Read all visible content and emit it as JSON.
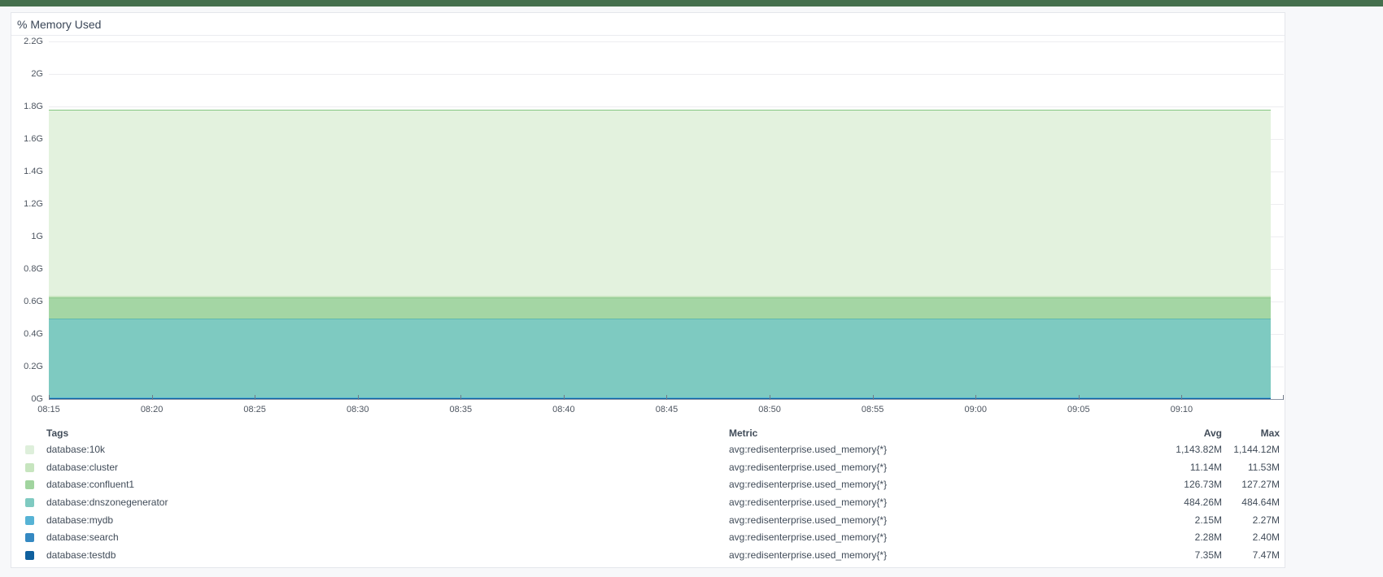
{
  "page": {
    "top_bar_color": "#45704d",
    "background_color": "#f7f8fa"
  },
  "panel": {
    "title": "% Memory Used"
  },
  "legend": {
    "headers": {
      "tags": "Tags",
      "metric": "Metric",
      "avg": "Avg",
      "max": "Max"
    }
  },
  "chart_data": {
    "type": "area",
    "stacked": true,
    "title": "% Memory Used",
    "grid": true,
    "legend_position": "bottom-table",
    "x_tick_labels": [
      "08:15",
      "08:20",
      "08:25",
      "08:30",
      "08:35",
      "08:40",
      "08:45",
      "08:50",
      "08:55",
      "09:00",
      "09:05",
      "09:10"
    ],
    "y_tick_labels": [
      "2.2G",
      "2G",
      "1.8G",
      "1.6G",
      "1.4G",
      "1.2G",
      "1G",
      "0.8G",
      "0.6G",
      "0.4G",
      "0.2G",
      "0G"
    ],
    "y_axis": {
      "unit": "G",
      "min_g": 0,
      "max_g": 2.2,
      "tick_step_g": 0.2
    },
    "x_range": [
      "08:15",
      "09:14"
    ],
    "series_shape": "flat-constant",
    "stack_order_bottom_to_top": [
      "database:testdb",
      "database:search",
      "database:mydb",
      "database:dnszonegenerator",
      "database:confluent1",
      "database:cluster",
      "database:10k"
    ],
    "series": [
      {
        "tag": "database:10k",
        "metric": "avg:redisenterprise.used_memory{*}",
        "avg_label": "1,143.82M",
        "max_label": "1,144.12M",
        "avg_mb": 1143.82,
        "max_mb": 1144.12,
        "swatch": "#deefdb",
        "fill": "#e3f2de",
        "stroke": "#85c682"
      },
      {
        "tag": "database:cluster",
        "metric": "avg:redisenterprise.used_memory{*}",
        "avg_label": "11.14M",
        "max_label": "11.53M",
        "avg_mb": 11.14,
        "max_mb": 11.53,
        "swatch": "#c7e5bf",
        "fill": "#c9e6c1",
        "stroke": "#c9e6c1"
      },
      {
        "tag": "database:confluent1",
        "metric": "avg:redisenterprise.used_memory{*}",
        "avg_label": "126.73M",
        "max_label": "127.27M",
        "avg_mb": 126.73,
        "max_mb": 127.27,
        "swatch": "#a1d49f",
        "fill": "#a4d6a4",
        "stroke": "#8bc78b"
      },
      {
        "tag": "database:dnszonegenerator",
        "metric": "avg:redisenterprise.used_memory{*}",
        "avg_label": "484.26M",
        "max_label": "484.64M",
        "avg_mb": 484.26,
        "max_mb": 484.64,
        "swatch": "#7fcac1",
        "fill": "#7ecac1",
        "stroke": "#5fb9ae"
      },
      {
        "tag": "database:mydb",
        "metric": "avg:redisenterprise.used_memory{*}",
        "avg_label": "2.15M",
        "max_label": "2.27M",
        "avg_mb": 2.15,
        "max_mb": 2.27,
        "swatch": "#56b3d5",
        "fill": "#56b3d5",
        "stroke": "#56b3d5"
      },
      {
        "tag": "database:search",
        "metric": "avg:redisenterprise.used_memory{*}",
        "avg_label": "2.28M",
        "max_label": "2.40M",
        "avg_mb": 2.28,
        "max_mb": 2.4,
        "swatch": "#3589c2",
        "fill": "#3589c2",
        "stroke": "#3589c2"
      },
      {
        "tag": "database:testdb",
        "metric": "avg:redisenterprise.used_memory{*}",
        "avg_label": "7.35M",
        "max_label": "7.47M",
        "avg_mb": 7.35,
        "max_mb": 7.47,
        "swatch": "#0f609e",
        "fill": "#0f609e",
        "stroke": "#0f609e"
      }
    ]
  }
}
